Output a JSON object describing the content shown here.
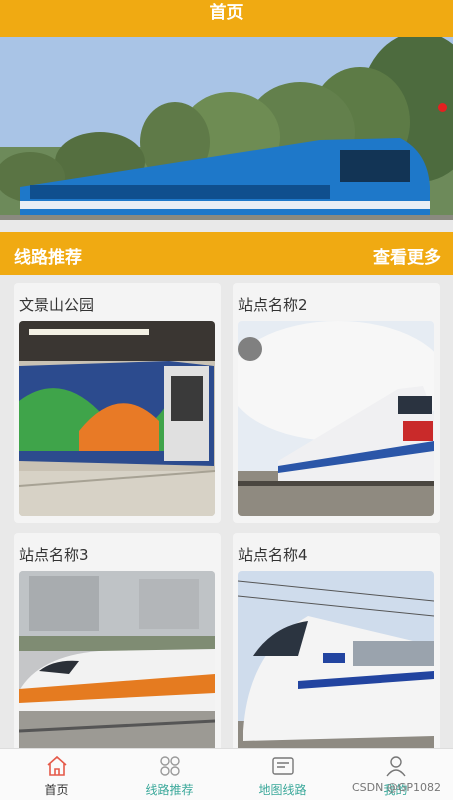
{
  "header": {
    "title": "首页"
  },
  "banner": {
    "image": "blue-train-photo"
  },
  "section": {
    "title": "线路推荐",
    "more_label": "查看更多"
  },
  "cards": [
    {
      "title": "文景山公园",
      "image": "colorful-train-photo"
    },
    {
      "title": "站点名称2",
      "image": "white-train-photo"
    },
    {
      "title": "站点名称3",
      "image": "high-speed-train-orange-photo"
    },
    {
      "title": "站点名称4",
      "image": "crh-train-photo"
    }
  ],
  "tabbar": {
    "items": [
      {
        "label": "首页",
        "icon": "home-icon",
        "active": true
      },
      {
        "label": "线路推荐",
        "icon": "grid-icon",
        "active": false
      },
      {
        "label": "地图线路",
        "icon": "map-icon",
        "active": false
      },
      {
        "label": "我的",
        "icon": "user-icon",
        "active": false
      }
    ]
  },
  "watermark": "CSDN @GP1082",
  "colors": {
    "accent": "#f0aa12",
    "tab_text": "#3aa89a",
    "active_icon": "#e55a4a"
  }
}
